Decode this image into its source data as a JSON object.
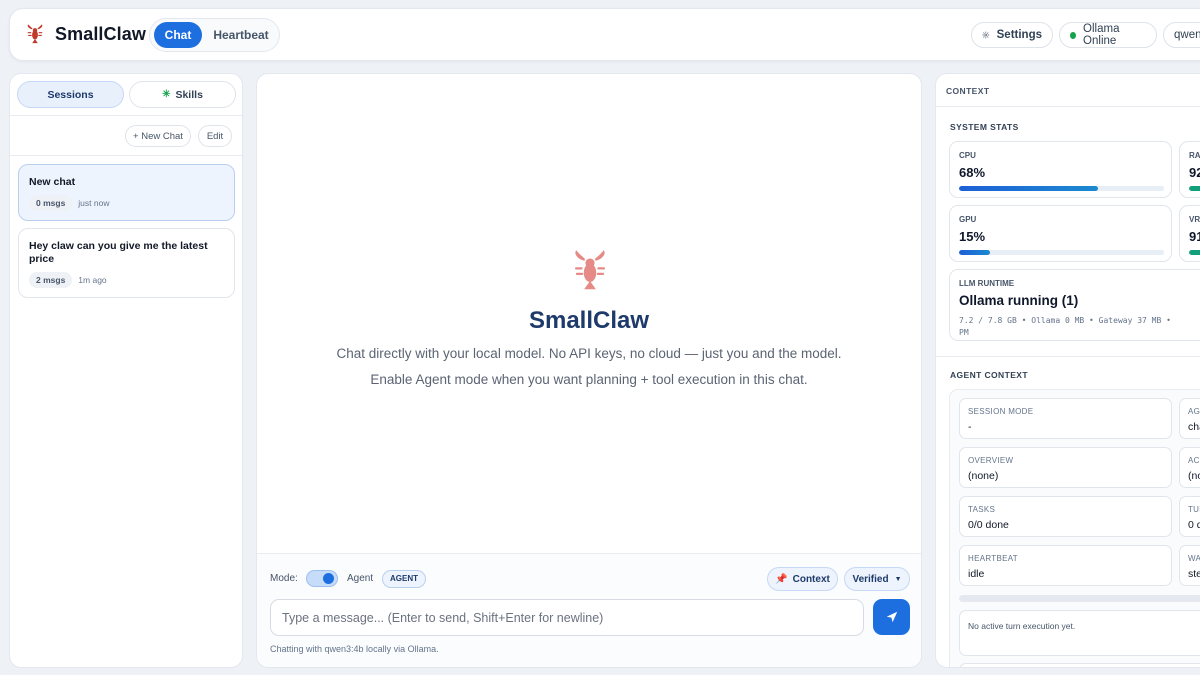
{
  "app": {
    "name": "SmallClaw"
  },
  "nav": {
    "tabs": [
      "Chat",
      "Heartbeat"
    ],
    "active": "Chat"
  },
  "topbar": {
    "settings_label": "Settings",
    "status_label": "Ollama Online",
    "model_label": "qwen"
  },
  "sidebar": {
    "tabs": [
      "Sessions",
      "Skills"
    ],
    "new_chat_label": "+ New Chat",
    "edit_label": "Edit",
    "sessions": [
      {
        "title": "New chat",
        "msgs": "0 msgs",
        "time": "just now",
        "active": true
      },
      {
        "title": "Hey claw can you give me the latest price",
        "msgs": "2 msgs",
        "time": "1m ago",
        "active": false
      }
    ]
  },
  "chat": {
    "hero_title": "SmallClaw",
    "hero_line1": "Chat directly with your local model. No API keys, no cloud — just you and the model.",
    "hero_line2": "Enable Agent mode when you want planning + tool execution in this chat.",
    "mode_label": "Mode:",
    "agent_label": "Agent",
    "agent_badge": "AGENT",
    "agent_mode_on": true,
    "context_button": "Context",
    "verified_select": "Verified",
    "input_placeholder": "Type a message... (Enter to send, Shift+Enter for newline)",
    "footnote": "Chatting with qwen3:4b locally via Ollama."
  },
  "context": {
    "title": "CONTEXT",
    "system_stats_title": "SYSTEM STATS",
    "stats": [
      {
        "label": "CPU",
        "value": "68%",
        "percent": 68
      },
      {
        "label": "RA",
        "value": "92",
        "percent": 92
      },
      {
        "label": "GPU",
        "value": "15%",
        "percent": 15
      },
      {
        "label": "VR",
        "value": "91",
        "percent": 91
      }
    ],
    "runtime_label": "LLM RUNTIME",
    "runtime_value": "Ollama running (1)",
    "runtime_detail": "7.2 / 7.8 GB • Ollama 0 MB • Gateway 37 MB •",
    "runtime_detail2": "PM",
    "agent_context_title": "AGENT CONTEXT",
    "fields": [
      {
        "key": "SESSION MODE",
        "value": "-"
      },
      {
        "key": "AG",
        "value": "cha"
      },
      {
        "key": "OVERVIEW",
        "value": "(none)"
      },
      {
        "key": "ACT",
        "value": "(no"
      },
      {
        "key": "TASKS",
        "value": "0/0 done"
      },
      {
        "key": "TUR",
        "value": "0 d"
      },
      {
        "key": "HEARTBEAT",
        "value": "idle"
      },
      {
        "key": "WA",
        "value": "ste"
      }
    ],
    "exec_note": "No active turn execution yet."
  },
  "colors": {
    "accent": "#1d6fe0",
    "heading": "#1e3a6b",
    "online": "#16a34a",
    "bar_green": "#12a07a"
  }
}
